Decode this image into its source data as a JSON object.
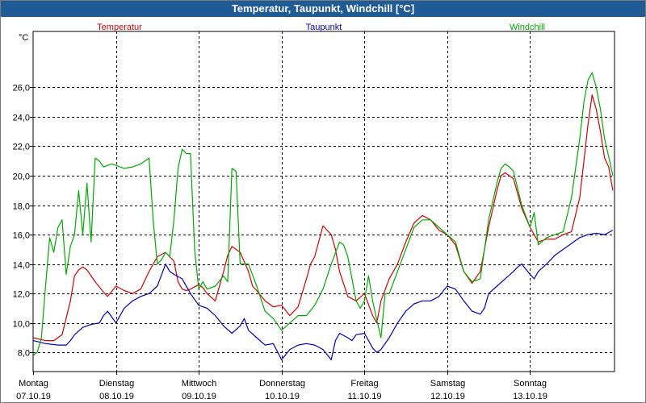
{
  "window": {
    "title": "Temperatur, Taupunkt, Windchill [°C]"
  },
  "chart_data": {
    "type": "line",
    "title": "Temperatur, Taupunkt, Windchill [°C]",
    "ylabel": "°C",
    "ylim": [
      6.7,
      29.8
    ],
    "xlim": [
      0,
      7.02
    ],
    "yticks": [
      8,
      10,
      12,
      14,
      16,
      18,
      20,
      22,
      24,
      26
    ],
    "ytick_labels": [
      "8,0",
      "10,0",
      "12,0",
      "14,0",
      "16,0",
      "18,0",
      "20,0",
      "22,0",
      "24,0",
      "26,0"
    ],
    "x_ticks": [
      {
        "x": 0,
        "day": "Montag",
        "date": "07.10.19"
      },
      {
        "x": 1,
        "day": "Dienstag",
        "date": "08.10.19"
      },
      {
        "x": 2,
        "day": "Mittwoch",
        "date": "09.10.19"
      },
      {
        "x": 3,
        "day": "Donnerstag",
        "date": "10.10.19"
      },
      {
        "x": 4,
        "day": "Freitag",
        "date": "11.10.19"
      },
      {
        "x": 5,
        "day": "Samstag",
        "date": "12.10.19"
      },
      {
        "x": 6,
        "day": "Sonntag",
        "date": "13.10.19"
      }
    ],
    "grid": true,
    "legend": "top",
    "series": [
      {
        "name": "Temperatur",
        "color": "#d40000",
        "x": [
          0.0,
          0.15,
          0.25,
          0.35,
          0.45,
          0.5,
          0.55,
          0.6,
          0.65,
          0.75,
          0.85,
          0.9,
          1.0,
          1.1,
          1.2,
          1.3,
          1.4,
          1.5,
          1.6,
          1.7,
          1.75,
          1.8,
          1.85,
          1.9,
          2.0,
          2.05,
          2.1,
          2.2,
          2.3,
          2.35,
          2.4,
          2.5,
          2.6,
          2.65,
          2.7,
          2.8,
          2.9,
          3.0,
          3.1,
          3.2,
          3.3,
          3.35,
          3.4,
          3.5,
          3.6,
          3.65,
          3.7,
          3.8,
          3.9,
          4.0,
          4.1,
          4.15,
          4.2,
          4.3,
          4.4,
          4.5,
          4.6,
          4.7,
          4.8,
          4.9,
          5.0,
          5.1,
          5.2,
          5.3,
          5.4,
          5.5,
          5.6,
          5.65,
          5.7,
          5.75,
          5.8,
          5.9,
          6.0,
          6.05,
          6.1,
          6.2,
          6.3,
          6.4,
          6.5,
          6.6,
          6.65,
          6.7,
          6.75,
          6.8,
          6.85,
          6.9,
          6.95,
          7.0
        ],
        "values": [
          9.0,
          8.8,
          8.8,
          9.2,
          11.5,
          13.2,
          13.6,
          13.8,
          13.6,
          12.8,
          12.1,
          11.8,
          12.5,
          12.2,
          12.0,
          12.3,
          13.5,
          14.5,
          14.8,
          14.2,
          12.8,
          12.3,
          12.2,
          12.3,
          12.6,
          12.4,
          12.0,
          11.5,
          13.5,
          14.6,
          15.2,
          14.8,
          13.5,
          12.5,
          12.2,
          11.5,
          11.1,
          11.2,
          10.5,
          11.1,
          13.0,
          14.0,
          14.5,
          16.6,
          16.0,
          15.0,
          13.5,
          11.8,
          11.5,
          12.0,
          10.5,
          10.0,
          11.5,
          13.0,
          14.0,
          15.5,
          16.8,
          17.3,
          17.0,
          16.3,
          16.0,
          15.3,
          13.5,
          12.7,
          13.5,
          16.5,
          19.0,
          20.0,
          20.2,
          20.0,
          19.8,
          17.8,
          16.5,
          16.0,
          15.5,
          15.7,
          15.7,
          16.0,
          16.2,
          18.5,
          21.0,
          23.5,
          25.5,
          24.5,
          23.0,
          21.2,
          20.6,
          19.0
        ]
      },
      {
        "name": "Taupunkt",
        "color": "#0000bb",
        "x": [
          0.0,
          0.15,
          0.3,
          0.4,
          0.45,
          0.5,
          0.6,
          0.7,
          0.8,
          0.85,
          0.9,
          0.95,
          1.0,
          1.1,
          1.2,
          1.3,
          1.4,
          1.5,
          1.6,
          1.65,
          1.7,
          1.8,
          1.9,
          2.0,
          2.1,
          2.2,
          2.3,
          2.4,
          2.5,
          2.55,
          2.6,
          2.7,
          2.8,
          2.9,
          3.0,
          3.1,
          3.2,
          3.3,
          3.4,
          3.5,
          3.6,
          3.65,
          3.7,
          3.8,
          3.85,
          3.9,
          4.0,
          4.1,
          4.15,
          4.2,
          4.3,
          4.4,
          4.5,
          4.6,
          4.7,
          4.8,
          4.9,
          5.0,
          5.1,
          5.2,
          5.3,
          5.4,
          5.45,
          5.5,
          5.6,
          5.7,
          5.8,
          5.85,
          5.9,
          6.0,
          6.05,
          6.1,
          6.2,
          6.3,
          6.4,
          6.5,
          6.6,
          6.7,
          6.8,
          6.9,
          7.0
        ],
        "values": [
          8.8,
          8.6,
          8.5,
          8.5,
          8.8,
          9.2,
          9.7,
          9.9,
          10.0,
          10.5,
          10.8,
          10.4,
          10.0,
          11.0,
          11.5,
          11.8,
          12.0,
          12.5,
          14.0,
          13.5,
          13.3,
          13.0,
          12.0,
          11.2,
          11.0,
          10.5,
          9.8,
          9.3,
          9.8,
          10.3,
          9.5,
          9.0,
          8.5,
          8.6,
          7.5,
          8.2,
          8.5,
          8.6,
          8.5,
          8.2,
          7.5,
          8.8,
          9.3,
          9.0,
          8.8,
          9.2,
          9.3,
          8.3,
          8.0,
          8.2,
          9.0,
          10.0,
          10.8,
          11.3,
          11.5,
          11.5,
          11.8,
          12.5,
          12.3,
          11.5,
          10.8,
          10.6,
          11.0,
          12.0,
          12.5,
          13.0,
          13.5,
          13.8,
          14.0,
          13.3,
          13.0,
          13.5,
          14.0,
          14.6,
          15.0,
          15.4,
          15.8,
          16.0,
          16.1,
          16.0,
          16.3
        ]
      },
      {
        "name": "Windchill",
        "color": "#00aa00",
        "x": [
          0.0,
          0.05,
          0.1,
          0.15,
          0.2,
          0.25,
          0.3,
          0.35,
          0.4,
          0.45,
          0.5,
          0.55,
          0.6,
          0.65,
          0.7,
          0.75,
          0.8,
          0.85,
          0.9,
          0.95,
          1.0,
          1.1,
          1.2,
          1.3,
          1.4,
          1.45,
          1.5,
          1.55,
          1.6,
          1.65,
          1.7,
          1.75,
          1.8,
          1.85,
          1.9,
          1.95,
          2.0,
          2.05,
          2.1,
          2.2,
          2.3,
          2.35,
          2.4,
          2.45,
          2.5,
          2.6,
          2.7,
          2.8,
          2.9,
          3.0,
          3.1,
          3.2,
          3.3,
          3.4,
          3.5,
          3.6,
          3.7,
          3.75,
          3.8,
          3.85,
          3.9,
          3.95,
          4.0,
          4.05,
          4.1,
          4.15,
          4.2,
          4.25,
          4.3,
          4.4,
          4.5,
          4.6,
          4.7,
          4.8,
          4.9,
          5.0,
          5.1,
          5.2,
          5.3,
          5.4,
          5.5,
          5.6,
          5.65,
          5.7,
          5.75,
          5.8,
          5.9,
          6.0,
          6.05,
          6.1,
          6.2,
          6.3,
          6.4,
          6.5,
          6.6,
          6.65,
          6.7,
          6.75,
          6.8,
          6.85,
          6.9,
          6.95,
          7.0
        ],
        "values": [
          7.8,
          8.0,
          9.0,
          12.5,
          15.8,
          14.8,
          16.5,
          17.0,
          13.3,
          15.2,
          16.0,
          19.0,
          16.0,
          19.5,
          15.5,
          21.2,
          21.0,
          20.6,
          20.7,
          20.8,
          20.7,
          20.5,
          20.6,
          20.8,
          21.2,
          17.0,
          14.0,
          14.3,
          14.8,
          14.5,
          17.0,
          20.5,
          21.8,
          21.5,
          21.5,
          15.0,
          12.3,
          12.8,
          12.3,
          12.5,
          13.2,
          12.8,
          20.5,
          20.3,
          14.0,
          14.0,
          12.5,
          10.8,
          10.3,
          9.5,
          10.0,
          10.5,
          10.5,
          11.2,
          12.3,
          14.0,
          15.5,
          15.3,
          14.5,
          13.0,
          11.5,
          11.0,
          11.5,
          13.2,
          11.5,
          10.2,
          9.0,
          12.0,
          12.0,
          13.5,
          15.0,
          16.5,
          17.0,
          17.0,
          16.5,
          16.0,
          15.5,
          13.5,
          12.8,
          13.0,
          17.0,
          19.5,
          20.5,
          20.8,
          20.6,
          20.3,
          18.0,
          16.5,
          17.5,
          15.3,
          15.8,
          16.0,
          16.2,
          18.5,
          22.5,
          25.0,
          26.5,
          27.0,
          26.0,
          24.5,
          22.5,
          21.3,
          20.0
        ]
      }
    ]
  }
}
